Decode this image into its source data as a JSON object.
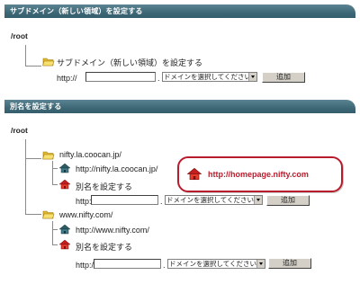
{
  "section1": {
    "title": "サブドメイン（新しい領域）を設定する",
    "root": "/root",
    "folder_label": "サブドメイン（新しい領域）を設定する",
    "http_prefix": "http://",
    "dot": ".",
    "domain_select": "ドメインを選択してください",
    "add_button": "追加"
  },
  "section2": {
    "title": "別名を設定する",
    "root": "/root",
    "domains": [
      {
        "folder": "nifty.la.coocan.jp/",
        "url": "http://nifty.la.coocan.jp/",
        "alias_label": "別名を設定する",
        "http_prefix": "http://",
        "dot": ".",
        "domain_select": "ドメインを選択してください",
        "add_button": "追加"
      },
      {
        "folder": "www.nifty.com/",
        "url": "http://www.nifty.com/",
        "alias_label": "別名を設定する",
        "http_prefix": "http://",
        "dot": ".",
        "domain_select": "ドメインを選択してください",
        "add_button": "追加"
      }
    ]
  },
  "callout": {
    "url": "http://homepage.nifty.com"
  },
  "icons": [
    "folder-icon",
    "house-teal-icon",
    "house-red-icon"
  ]
}
